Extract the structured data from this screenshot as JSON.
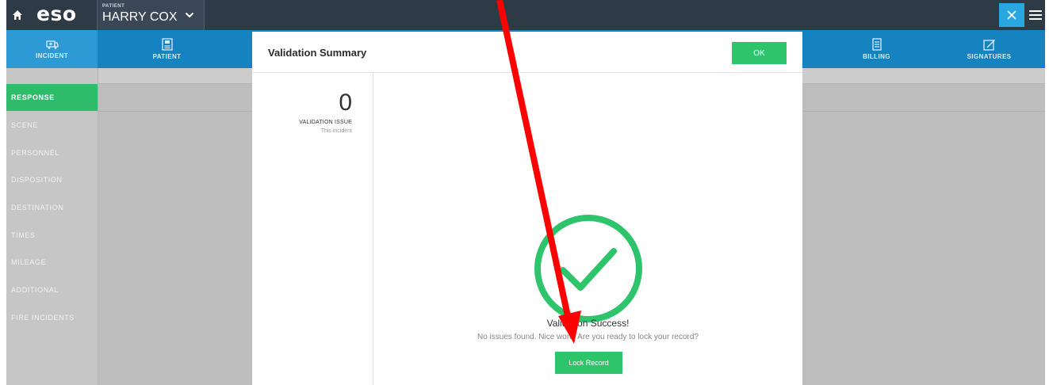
{
  "topbar": {
    "logo": "eso",
    "patient_kicker": "PATIENT",
    "patient_name": "HARRY COX"
  },
  "nav": {
    "tabs": [
      {
        "label": "INCIDENT",
        "icon": "ambulance-icon",
        "active": true
      },
      {
        "label": "PATIENT",
        "icon": "patient-chart-icon",
        "active": false
      },
      {
        "label": "BILLING",
        "icon": "billing-document-icon",
        "active": false
      },
      {
        "label": "SIGNATURES",
        "icon": "signature-pen-icon",
        "active": false
      }
    ]
  },
  "sidebar": {
    "items": [
      {
        "label": "RESPONSE",
        "active": true
      },
      {
        "label": "SCENE",
        "active": false
      },
      {
        "label": "PERSONNEL",
        "active": false
      },
      {
        "label": "DISPOSITION",
        "active": false
      },
      {
        "label": "DESTINATION",
        "active": false
      },
      {
        "label": "TIMES",
        "active": false
      },
      {
        "label": "MILEAGE",
        "active": false
      },
      {
        "label": "ADDITIONAL",
        "active": false
      },
      {
        "label": "FIRE INCIDENTS",
        "active": false
      }
    ]
  },
  "modal": {
    "title": "Validation Summary",
    "ok_label": "OK",
    "issue_count": "0",
    "issue_label": "VALIDATION ISSUE",
    "issue_scope": "This incident",
    "success_title": "Validation Success!",
    "success_message": "No issues found. Nice work! Are you ready to lock your record?",
    "lock_label": "Lock Record"
  },
  "colors": {
    "topbar": "#2f3a47",
    "nav": "#1583bf",
    "accent_green": "#2ec46c",
    "close_blue": "#29a7e1",
    "annotation_arrow": "#ff0000"
  }
}
